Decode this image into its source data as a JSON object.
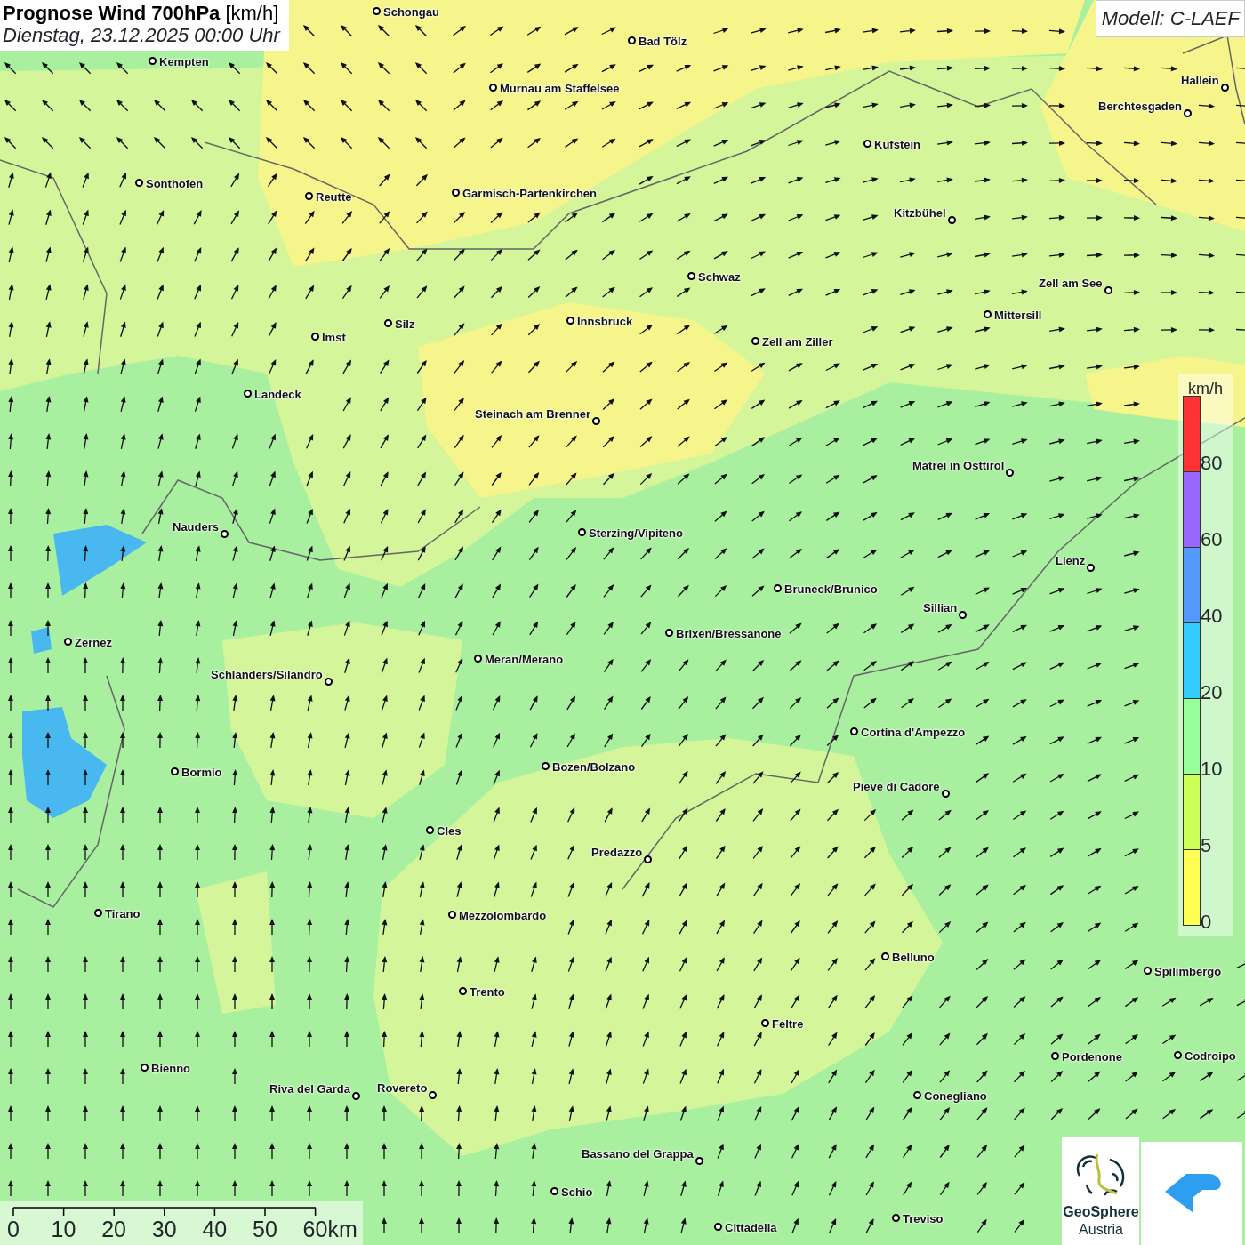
{
  "title": "**Prognose Wind 700hPa** [km/h]",
  "subtitle": "Dienstag, 23.12.2025 00:00 Uhr",
  "model": "Modell: C-LAEF",
  "cities": [
    {
      "name": "Schongau"
    },
    {
      "name": "Bad Tölz"
    },
    {
      "name": "Kempten"
    },
    {
      "name": "Murnau am Staffelsee"
    },
    {
      "name": "Hallein"
    },
    {
      "name": "Berchtesgaden"
    },
    {
      "name": "Kufstein"
    },
    {
      "name": "Sonthofen"
    },
    {
      "name": "Reutte"
    },
    {
      "name": "Garmisch-Partenkirchen"
    },
    {
      "name": "Kitzbühel"
    },
    {
      "name": "Schwaz"
    },
    {
      "name": "Zell am See"
    },
    {
      "name": "Innsbruck"
    },
    {
      "name": "Mittersill"
    },
    {
      "name": "Silz"
    },
    {
      "name": "Imst"
    },
    {
      "name": "Zell am Ziller"
    },
    {
      "name": "Landeck"
    },
    {
      "name": "Steinach am Brenner"
    },
    {
      "name": "Matrei in Osttirol"
    },
    {
      "name": "Nauders"
    },
    {
      "name": "Sterzing/Vipiteno"
    },
    {
      "name": "Lienz"
    },
    {
      "name": "Bruneck/Brunico"
    },
    {
      "name": "Sillian"
    },
    {
      "name": "Brixen/Bressanone"
    },
    {
      "name": "Zernez"
    },
    {
      "name": "Meran/Merano"
    },
    {
      "name": "Schlanders/Silandro"
    },
    {
      "name": "Cortina d'Ampezzo"
    },
    {
      "name": "Bozen/Bolzano"
    },
    {
      "name": "Bormio"
    },
    {
      "name": "Pieve di Cadore"
    },
    {
      "name": "Cles"
    },
    {
      "name": "Predazzo"
    },
    {
      "name": "Tirano"
    },
    {
      "name": "Mezzolombardo"
    },
    {
      "name": "Belluno"
    },
    {
      "name": "Spilimbergo"
    },
    {
      "name": "Trento"
    },
    {
      "name": "Feltre"
    },
    {
      "name": "Pordenone"
    },
    {
      "name": "Codroipo"
    },
    {
      "name": "Bienno"
    },
    {
      "name": "Riva del Garda"
    },
    {
      "name": "Rovereto"
    },
    {
      "name": "Conegliano"
    },
    {
      "name": "Bassano del Grappa"
    },
    {
      "name": "Schio"
    },
    {
      "name": "Treviso"
    },
    {
      "name": "Cittadella"
    }
  ],
  "legend": {
    "unit": "km/h",
    "bins": [
      {
        "label": "80",
        "color": "#ff3333"
      },
      {
        "label": "60",
        "color": "#9966ff"
      },
      {
        "label": "40",
        "color": "#5599ff"
      },
      {
        "label": "20",
        "color": "#33ccff"
      },
      {
        "label": "10",
        "color": "#99ff99"
      },
      {
        "label": "5",
        "color": "#ccff55"
      },
      {
        "label": "0",
        "color": "#ffff55"
      }
    ]
  },
  "scale_bar": {
    "ticks": [
      "0",
      "10",
      "20",
      "30",
      "40",
      "50",
      "60km"
    ]
  },
  "logos": {
    "geosphere": {
      "line1": "GeoSphere",
      "line2": "Austria"
    }
  }
}
